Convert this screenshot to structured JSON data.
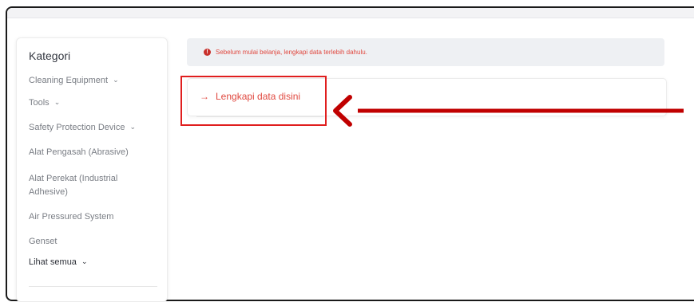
{
  "sidebar": {
    "title": "Kategori",
    "items": [
      {
        "label": "Cleaning Equipment",
        "has_dropdown": true
      },
      {
        "label": "Tools",
        "has_dropdown": true
      },
      {
        "label": "Safety Protection Device",
        "has_dropdown": true
      },
      {
        "label": "Alat Pengasah (Abrasive)",
        "has_dropdown": false
      },
      {
        "label": "Alat Perekat (Industrial Adhesive)",
        "has_dropdown": false
      },
      {
        "label": "Air Pressured System",
        "has_dropdown": false
      },
      {
        "label": "Genset",
        "has_dropdown": false
      }
    ],
    "see_all_label": "Lihat semua",
    "chevron_icon": "chevron-down-icon"
  },
  "alert": {
    "icon": "exclamation-circle-icon",
    "icon_glyph": "!",
    "message": "Sebelum mulai belanja, lengkapi data terlebih dahulu."
  },
  "cta": {
    "icon": "arrow-right-icon",
    "arrow_glyph": "→",
    "label": "Lengkapi data disini"
  },
  "colors": {
    "accent": "#e0483f",
    "highlight": "#e01e1e",
    "pointer": "#c00000",
    "alert_background": "#eef0f3"
  }
}
